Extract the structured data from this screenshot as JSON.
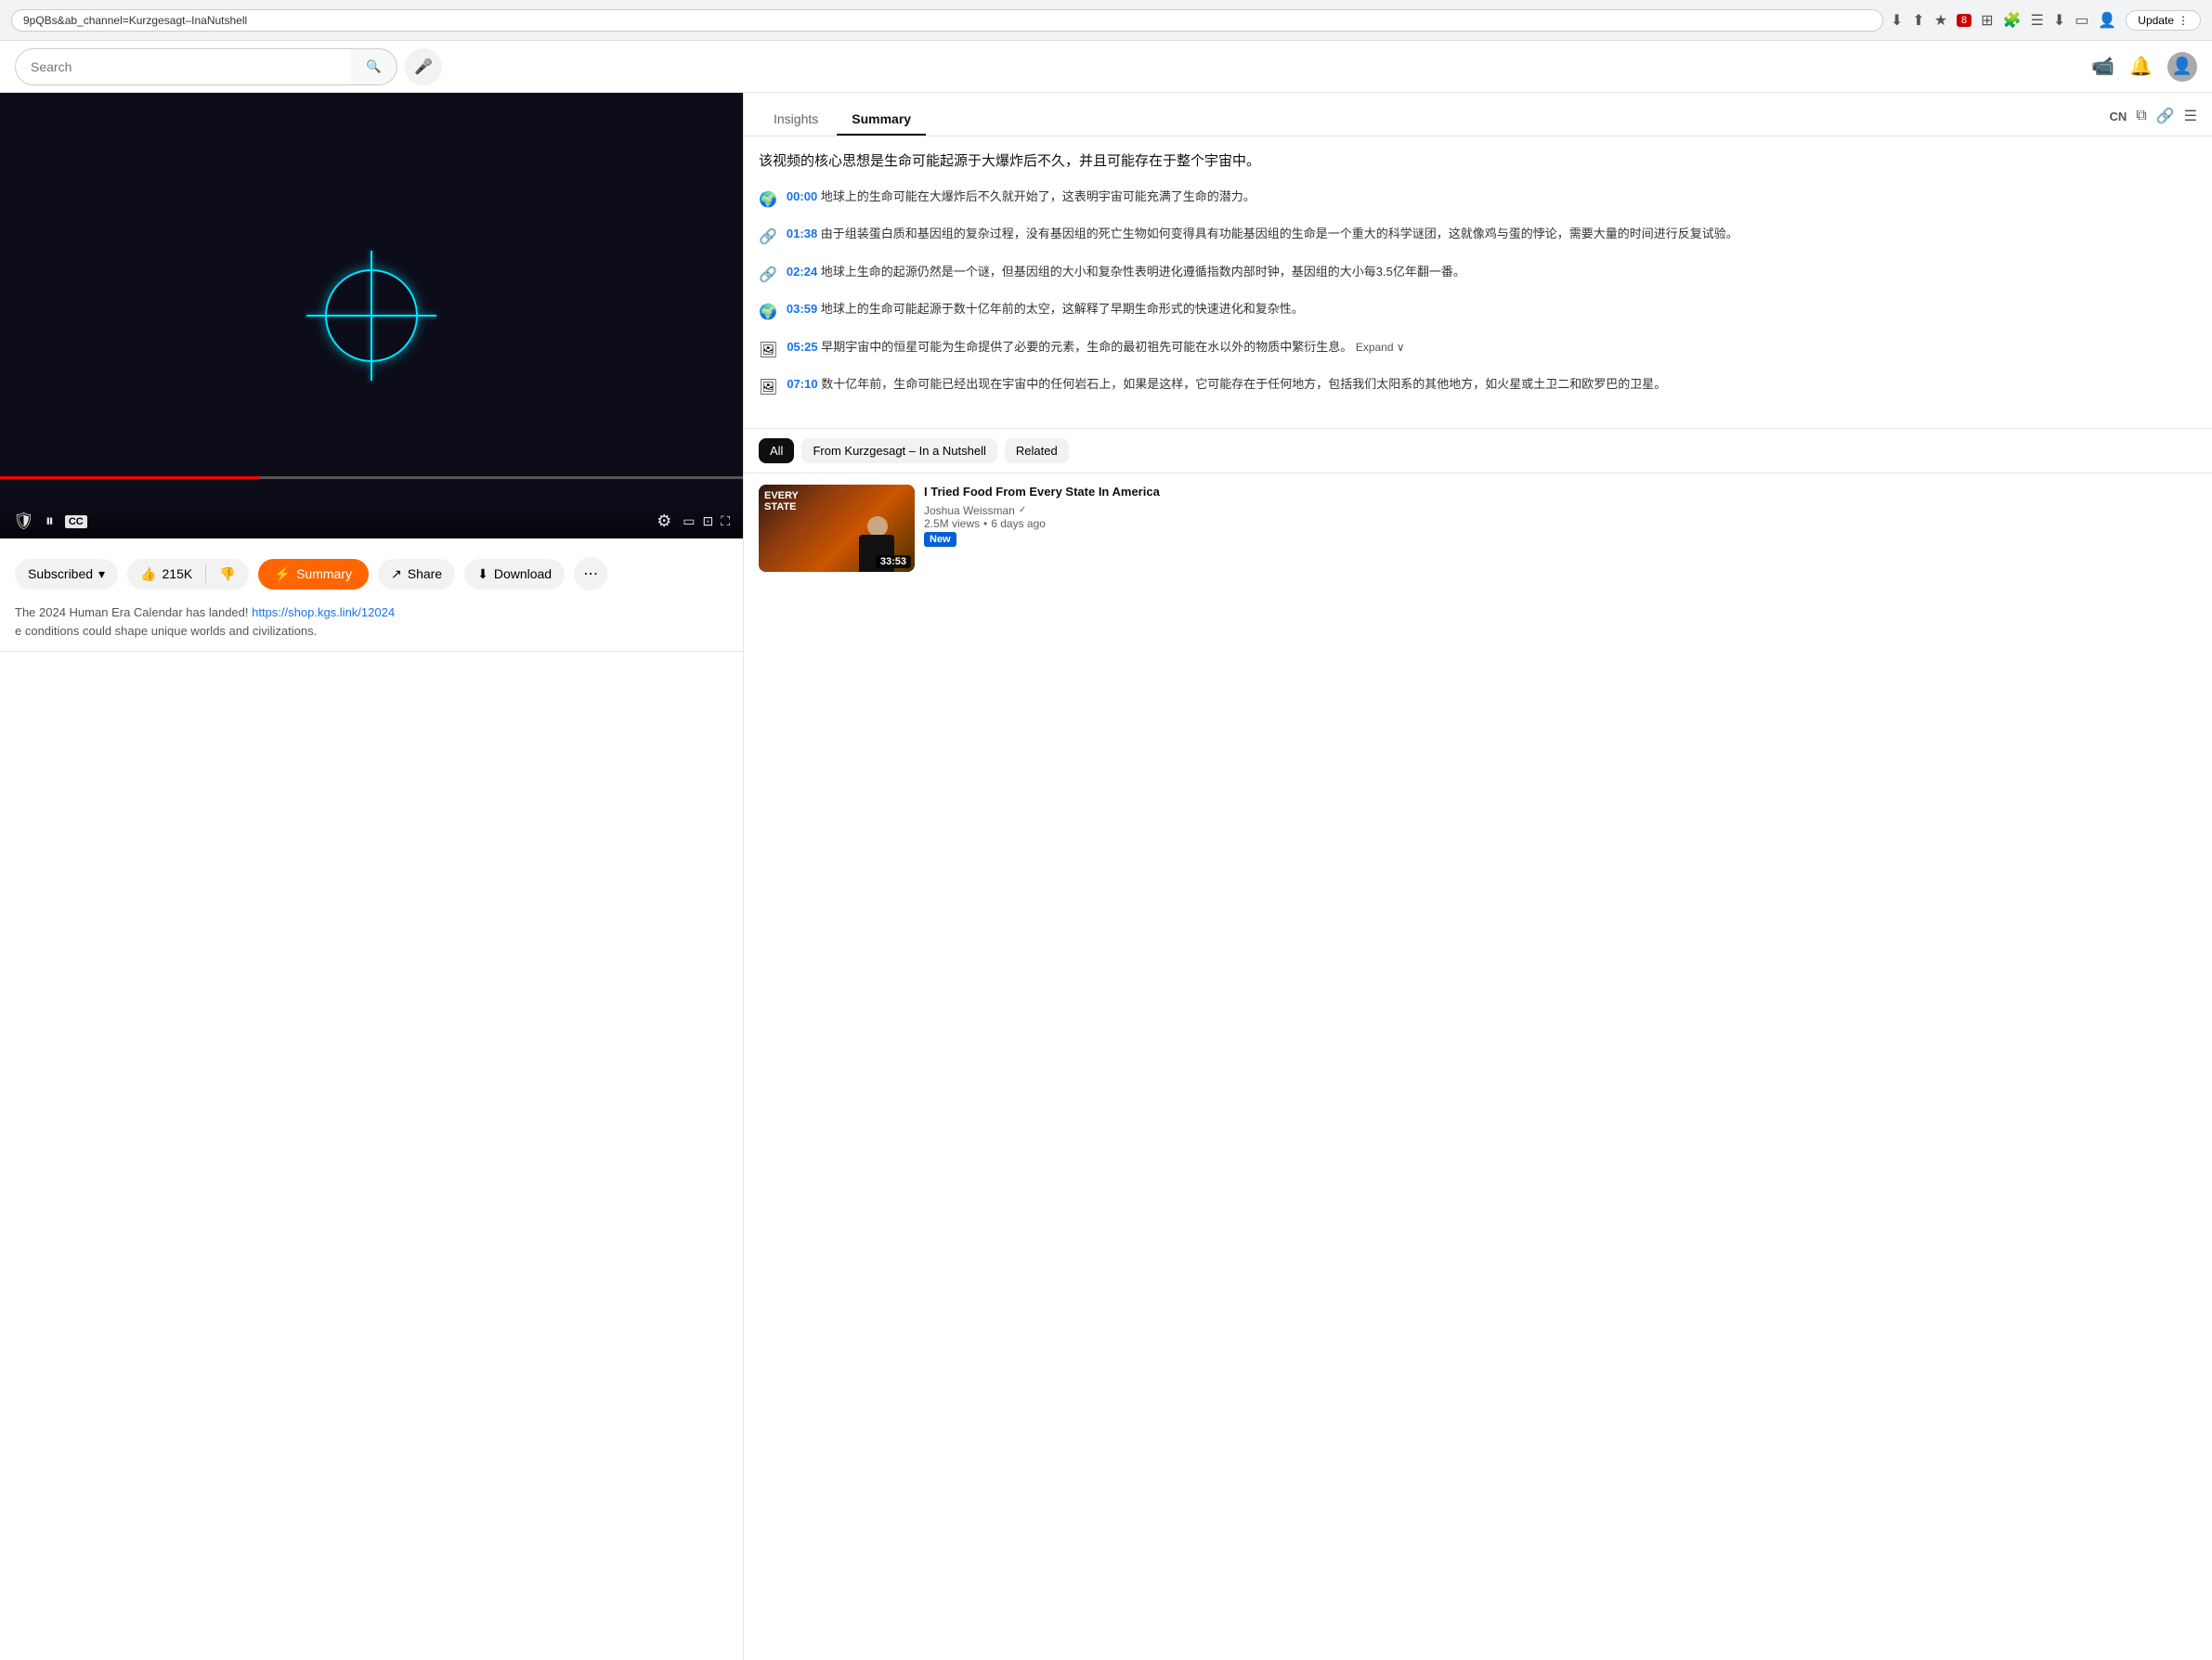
{
  "browser": {
    "url": "9pQBs&ab_channel=Kurzgesagt–InaNutshell",
    "update_label": "Update",
    "icons": [
      "⬇",
      "⬆",
      "★",
      "🔴8",
      "⊞",
      "🧩",
      "☰",
      "⬇",
      "▭",
      "👤"
    ]
  },
  "header": {
    "search_placeholder": "Search",
    "mic_icon": "🎤",
    "search_icon": "🔍",
    "add_video_icon": "📹",
    "bell_icon": "🔔",
    "avatar_icon": "👤"
  },
  "video": {
    "progress_pct": 35,
    "controls": {
      "play_icon": "⏸",
      "shield_icon": "🛡",
      "cc_label": "CC",
      "settings_icon": "⚙",
      "miniplayer_icon": "▭",
      "fullscreen_icon": "⛶",
      "theater_icon": "⊡"
    }
  },
  "actions": {
    "subscribed_label": "Subscribed",
    "like_count": "215K",
    "like_icon": "👍",
    "dislike_icon": "👎",
    "summary_label": "Summary",
    "summary_icon": "⚡",
    "share_icon": "↗",
    "share_label": "Share",
    "download_icon": "⬇",
    "download_label": "Download",
    "more_icon": "⋯"
  },
  "description": {
    "line1": "The 2024 Human Era Calendar has landed!",
    "link": "https://shop.kgs.link/12024",
    "line2": "e conditions could shape unique worlds and civilizations."
  },
  "summary_panel": {
    "insights_tab": "Insights",
    "summary_tab": "Summary",
    "lang": "CN",
    "copy_icon": "⧉",
    "link_icon": "🔗",
    "menu_icon": "☰",
    "intro_text": "该视频的核心思想是生命可能起源于大爆炸后不久，并且可能存在于整个宇宙中。",
    "items": [
      {
        "icon": "🌍",
        "time": "00:00",
        "text": "地球上的生命可能在大爆炸后不久就开始了，这表明宇宙可能充满了生命的潜力。"
      },
      {
        "icon": "🔗",
        "time": "01:38",
        "text": "由于组装蛋白质和基因组的复杂过程，没有基因组的死亡生物如何变得具有功能基因组的生命是一个重大的科学谜团，这就像鸡与蛋的悖论，需要大量的时间进行反复试验。"
      },
      {
        "icon": "🔗",
        "time": "02:24",
        "text": "地球上生命的起源仍然是一个谜，但基因组的大小和复杂性表明进化遵循指数内部时钟，基因组的大小每3.5亿年翻一番。"
      },
      {
        "icon": "🌍",
        "time": "03:59",
        "text": "地球上的生命可能起源于数十亿年前的太空，这解释了早期生命形式的快速进化和复杂性。"
      },
      {
        "icon": "🖼",
        "time": "05:25",
        "text": "早期宇宙中的恒星可能为生命提供了必要的元素，生命的最初祖先可能在水以外的物质中繁衍生息。",
        "expand": "Expand"
      },
      {
        "icon": "🖼",
        "time": "07:10",
        "text": "数十亿年前，生命可能已经出现在宇宙中的任何岩石上，如果是这样，它可能存在于任何地方，包括我们太阳系的其他地方，如火星或土卫二和欧罗巴的卫星。"
      }
    ]
  },
  "filters": {
    "items": [
      {
        "label": "All",
        "active": true
      },
      {
        "label": "From Kurzgesagt – In a Nutshell",
        "active": false
      },
      {
        "label": "Related",
        "active": false
      }
    ]
  },
  "related": {
    "label": "Related",
    "videos": [
      {
        "title": "I Tried Food From Every State In America",
        "channel": "Joshua Weissman",
        "verified": true,
        "views": "2.5M views",
        "age": "6 days ago",
        "duration": "33:53",
        "is_new": true,
        "thumb_type": "food"
      }
    ]
  }
}
